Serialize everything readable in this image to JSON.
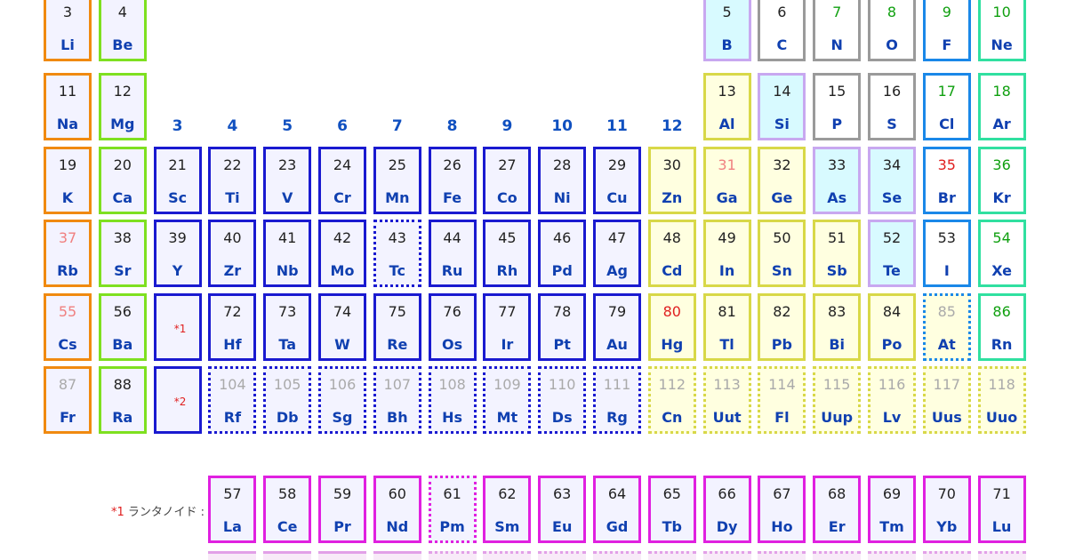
{
  "group_headers": [
    "3",
    "4",
    "5",
    "6",
    "7",
    "8",
    "9",
    "10",
    "11",
    "12"
  ],
  "refs": [
    {
      "id": "ref1",
      "text": "*1",
      "row": 5
    },
    {
      "id": "ref2",
      "text": "*2",
      "row": 6
    }
  ],
  "lanthanoid_label": {
    "mark": "*1",
    "text": " ランタノイド :"
  },
  "colors": {
    "alkali": "#f08a10",
    "alkaline": "#7ee020",
    "transition": "#1a1ad0",
    "post": "#d8d848",
    "metalloid": "#c8a8f0",
    "nonmetal": "#9a9a9a",
    "halogen": "#1a88e8",
    "noble": "#30e0a0",
    "lanthanoid": "#e020e0",
    "num_solid": "#e02020",
    "num_liquid": "#e02020",
    "num_gas": "#10a010",
    "num_synthetic": "#aaaaaa",
    "num_default": "#222222",
    "num_special": "#f08080"
  },
  "elements": [
    {
      "n": "3",
      "s": "Li",
      "r": 1,
      "c": 1,
      "cat": "alkali"
    },
    {
      "n": "4",
      "s": "Be",
      "r": 1,
      "c": 2,
      "cat": "alkaline"
    },
    {
      "n": "5",
      "s": "B",
      "r": 1,
      "c": 13,
      "cat": "metalloid"
    },
    {
      "n": "6",
      "s": "C",
      "r": 1,
      "c": 14,
      "cat": "nonmetal"
    },
    {
      "n": "7",
      "s": "N",
      "r": 1,
      "c": 15,
      "cat": "nonmetal",
      "nc": "gas"
    },
    {
      "n": "8",
      "s": "O",
      "r": 1,
      "c": 16,
      "cat": "nonmetal",
      "nc": "gas"
    },
    {
      "n": "9",
      "s": "F",
      "r": 1,
      "c": 17,
      "cat": "halogen",
      "nc": "gas"
    },
    {
      "n": "10",
      "s": "Ne",
      "r": 1,
      "c": 18,
      "cat": "noble",
      "nc": "gas"
    },
    {
      "n": "11",
      "s": "Na",
      "r": 2,
      "c": 1,
      "cat": "alkali"
    },
    {
      "n": "12",
      "s": "Mg",
      "r": 2,
      "c": 2,
      "cat": "alkaline"
    },
    {
      "n": "13",
      "s": "Al",
      "r": 2,
      "c": 13,
      "cat": "post"
    },
    {
      "n": "14",
      "s": "Si",
      "r": 2,
      "c": 14,
      "cat": "metalloid"
    },
    {
      "n": "15",
      "s": "P",
      "r": 2,
      "c": 15,
      "cat": "nonmetal"
    },
    {
      "n": "16",
      "s": "S",
      "r": 2,
      "c": 16,
      "cat": "nonmetal"
    },
    {
      "n": "17",
      "s": "Cl",
      "r": 2,
      "c": 17,
      "cat": "halogen",
      "nc": "gas"
    },
    {
      "n": "18",
      "s": "Ar",
      "r": 2,
      "c": 18,
      "cat": "noble",
      "nc": "gas"
    },
    {
      "n": "19",
      "s": "K",
      "r": 3,
      "c": 1,
      "cat": "alkali"
    },
    {
      "n": "20",
      "s": "Ca",
      "r": 3,
      "c": 2,
      "cat": "alkaline"
    },
    {
      "n": "21",
      "s": "Sc",
      "r": 3,
      "c": 3,
      "cat": "transition"
    },
    {
      "n": "22",
      "s": "Ti",
      "r": 3,
      "c": 4,
      "cat": "transition"
    },
    {
      "n": "23",
      "s": "V",
      "r": 3,
      "c": 5,
      "cat": "transition"
    },
    {
      "n": "24",
      "s": "Cr",
      "r": 3,
      "c": 6,
      "cat": "transition"
    },
    {
      "n": "25",
      "s": "Mn",
      "r": 3,
      "c": 7,
      "cat": "transition"
    },
    {
      "n": "26",
      "s": "Fe",
      "r": 3,
      "c": 8,
      "cat": "transition"
    },
    {
      "n": "27",
      "s": "Co",
      "r": 3,
      "c": 9,
      "cat": "transition"
    },
    {
      "n": "28",
      "s": "Ni",
      "r": 3,
      "c": 10,
      "cat": "transition"
    },
    {
      "n": "29",
      "s": "Cu",
      "r": 3,
      "c": 11,
      "cat": "transition"
    },
    {
      "n": "30",
      "s": "Zn",
      "r": 3,
      "c": 12,
      "cat": "post"
    },
    {
      "n": "31",
      "s": "Ga",
      "r": 3,
      "c": 13,
      "cat": "post",
      "nc": "special"
    },
    {
      "n": "32",
      "s": "Ge",
      "r": 3,
      "c": 14,
      "cat": "post"
    },
    {
      "n": "33",
      "s": "As",
      "r": 3,
      "c": 15,
      "cat": "metalloid"
    },
    {
      "n": "34",
      "s": "Se",
      "r": 3,
      "c": 16,
      "cat": "metalloid"
    },
    {
      "n": "35",
      "s": "Br",
      "r": 3,
      "c": 17,
      "cat": "halogen",
      "nc": "liquid"
    },
    {
      "n": "36",
      "s": "Kr",
      "r": 3,
      "c": 18,
      "cat": "noble",
      "nc": "gas"
    },
    {
      "n": "37",
      "s": "Rb",
      "r": 4,
      "c": 1,
      "cat": "alkali",
      "nc": "special"
    },
    {
      "n": "38",
      "s": "Sr",
      "r": 4,
      "c": 2,
      "cat": "alkaline"
    },
    {
      "n": "39",
      "s": "Y",
      "r": 4,
      "c": 3,
      "cat": "transition"
    },
    {
      "n": "40",
      "s": "Zr",
      "r": 4,
      "c": 4,
      "cat": "transition"
    },
    {
      "n": "41",
      "s": "Nb",
      "r": 4,
      "c": 5,
      "cat": "transition"
    },
    {
      "n": "42",
      "s": "Mo",
      "r": 4,
      "c": 6,
      "cat": "transition"
    },
    {
      "n": "43",
      "s": "Tc",
      "r": 4,
      "c": 7,
      "cat": "transition",
      "dotted": true
    },
    {
      "n": "44",
      "s": "Ru",
      "r": 4,
      "c": 8,
      "cat": "transition"
    },
    {
      "n": "45",
      "s": "Rh",
      "r": 4,
      "c": 9,
      "cat": "transition"
    },
    {
      "n": "46",
      "s": "Pd",
      "r": 4,
      "c": 10,
      "cat": "transition"
    },
    {
      "n": "47",
      "s": "Ag",
      "r": 4,
      "c": 11,
      "cat": "transition"
    },
    {
      "n": "48",
      "s": "Cd",
      "r": 4,
      "c": 12,
      "cat": "post"
    },
    {
      "n": "49",
      "s": "In",
      "r": 4,
      "c": 13,
      "cat": "post"
    },
    {
      "n": "50",
      "s": "Sn",
      "r": 4,
      "c": 14,
      "cat": "post"
    },
    {
      "n": "51",
      "s": "Sb",
      "r": 4,
      "c": 15,
      "cat": "post"
    },
    {
      "n": "52",
      "s": "Te",
      "r": 4,
      "c": 16,
      "cat": "metalloid"
    },
    {
      "n": "53",
      "s": "I",
      "r": 4,
      "c": 17,
      "cat": "halogen"
    },
    {
      "n": "54",
      "s": "Xe",
      "r": 4,
      "c": 18,
      "cat": "noble",
      "nc": "gas"
    },
    {
      "n": "55",
      "s": "Cs",
      "r": 5,
      "c": 1,
      "cat": "alkali",
      "nc": "special"
    },
    {
      "n": "56",
      "s": "Ba",
      "r": 5,
      "c": 2,
      "cat": "alkaline"
    },
    {
      "n": "72",
      "s": "Hf",
      "r": 5,
      "c": 4,
      "cat": "transition"
    },
    {
      "n": "73",
      "s": "Ta",
      "r": 5,
      "c": 5,
      "cat": "transition"
    },
    {
      "n": "74",
      "s": "W",
      "r": 5,
      "c": 6,
      "cat": "transition"
    },
    {
      "n": "75",
      "s": "Re",
      "r": 5,
      "c": 7,
      "cat": "transition"
    },
    {
      "n": "76",
      "s": "Os",
      "r": 5,
      "c": 8,
      "cat": "transition"
    },
    {
      "n": "77",
      "s": "Ir",
      "r": 5,
      "c": 9,
      "cat": "transition"
    },
    {
      "n": "78",
      "s": "Pt",
      "r": 5,
      "c": 10,
      "cat": "transition"
    },
    {
      "n": "79",
      "s": "Au",
      "r": 5,
      "c": 11,
      "cat": "transition"
    },
    {
      "n": "80",
      "s": "Hg",
      "r": 5,
      "c": 12,
      "cat": "post",
      "nc": "liquid"
    },
    {
      "n": "81",
      "s": "Tl",
      "r": 5,
      "c": 13,
      "cat": "post"
    },
    {
      "n": "82",
      "s": "Pb",
      "r": 5,
      "c": 14,
      "cat": "post"
    },
    {
      "n": "83",
      "s": "Bi",
      "r": 5,
      "c": 15,
      "cat": "post"
    },
    {
      "n": "84",
      "s": "Po",
      "r": 5,
      "c": 16,
      "cat": "post"
    },
    {
      "n": "85",
      "s": "At",
      "r": 5,
      "c": 17,
      "cat": "halogen",
      "nc": "synthetic",
      "dotted": true
    },
    {
      "n": "86",
      "s": "Rn",
      "r": 5,
      "c": 18,
      "cat": "noble",
      "nc": "gas"
    },
    {
      "n": "87",
      "s": "Fr",
      "r": 6,
      "c": 1,
      "cat": "alkali",
      "nc": "synthetic"
    },
    {
      "n": "88",
      "s": "Ra",
      "r": 6,
      "c": 2,
      "cat": "alkaline"
    },
    {
      "n": "104",
      "s": "Rf",
      "r": 6,
      "c": 4,
      "cat": "transition",
      "nc": "synthetic",
      "dotted": true
    },
    {
      "n": "105",
      "s": "Db",
      "r": 6,
      "c": 5,
      "cat": "transition",
      "nc": "synthetic",
      "dotted": true
    },
    {
      "n": "106",
      "s": "Sg",
      "r": 6,
      "c": 6,
      "cat": "transition",
      "nc": "synthetic",
      "dotted": true
    },
    {
      "n": "107",
      "s": "Bh",
      "r": 6,
      "c": 7,
      "cat": "transition",
      "nc": "synthetic",
      "dotted": true
    },
    {
      "n": "108",
      "s": "Hs",
      "r": 6,
      "c": 8,
      "cat": "transition",
      "nc": "synthetic",
      "dotted": true
    },
    {
      "n": "109",
      "s": "Mt",
      "r": 6,
      "c": 9,
      "cat": "transition",
      "nc": "synthetic",
      "dotted": true
    },
    {
      "n": "110",
      "s": "Ds",
      "r": 6,
      "c": 10,
      "cat": "transition",
      "nc": "synthetic",
      "dotted": true
    },
    {
      "n": "111",
      "s": "Rg",
      "r": 6,
      "c": 11,
      "cat": "transition",
      "nc": "synthetic",
      "dotted": true
    },
    {
      "n": "112",
      "s": "Cn",
      "r": 6,
      "c": 12,
      "cat": "post",
      "nc": "synthetic",
      "dotted": true
    },
    {
      "n": "113",
      "s": "Uut",
      "r": 6,
      "c": 13,
      "cat": "post",
      "nc": "synthetic",
      "dotted": true
    },
    {
      "n": "114",
      "s": "Fl",
      "r": 6,
      "c": 14,
      "cat": "post",
      "nc": "synthetic",
      "dotted": true
    },
    {
      "n": "115",
      "s": "Uup",
      "r": 6,
      "c": 15,
      "cat": "post",
      "nc": "synthetic",
      "dotted": true
    },
    {
      "n": "116",
      "s": "Lv",
      "r": 6,
      "c": 16,
      "cat": "post",
      "nc": "synthetic",
      "dotted": true
    },
    {
      "n": "117",
      "s": "Uus",
      "r": 6,
      "c": 17,
      "cat": "post",
      "nc": "synthetic",
      "dotted": true
    },
    {
      "n": "118",
      "s": "Uuo",
      "r": 6,
      "c": 18,
      "cat": "post",
      "nc": "synthetic",
      "dotted": true
    },
    {
      "n": "57",
      "s": "La",
      "r": 7,
      "c": 4,
      "cat": "lanthanoid"
    },
    {
      "n": "58",
      "s": "Ce",
      "r": 7,
      "c": 5,
      "cat": "lanthanoid"
    },
    {
      "n": "59",
      "s": "Pr",
      "r": 7,
      "c": 6,
      "cat": "lanthanoid"
    },
    {
      "n": "60",
      "s": "Nd",
      "r": 7,
      "c": 7,
      "cat": "lanthanoid"
    },
    {
      "n": "61",
      "s": "Pm",
      "r": 7,
      "c": 8,
      "cat": "lanthanoid",
      "dotted": true
    },
    {
      "n": "62",
      "s": "Sm",
      "r": 7,
      "c": 9,
      "cat": "lanthanoid"
    },
    {
      "n": "63",
      "s": "Eu",
      "r": 7,
      "c": 10,
      "cat": "lanthanoid"
    },
    {
      "n": "64",
      "s": "Gd",
      "r": 7,
      "c": 11,
      "cat": "lanthanoid"
    },
    {
      "n": "65",
      "s": "Tb",
      "r": 7,
      "c": 12,
      "cat": "lanthanoid"
    },
    {
      "n": "66",
      "s": "Dy",
      "r": 7,
      "c": 13,
      "cat": "lanthanoid"
    },
    {
      "n": "67",
      "s": "Ho",
      "r": 7,
      "c": 14,
      "cat": "lanthanoid"
    },
    {
      "n": "68",
      "s": "Er",
      "r": 7,
      "c": 15,
      "cat": "lanthanoid"
    },
    {
      "n": "69",
      "s": "Tm",
      "r": 7,
      "c": 16,
      "cat": "lanthanoid"
    },
    {
      "n": "70",
      "s": "Yb",
      "r": 7,
      "c": 17,
      "cat": "lanthanoid"
    },
    {
      "n": "71",
      "s": "Lu",
      "r": 7,
      "c": 18,
      "cat": "lanthanoid"
    }
  ]
}
